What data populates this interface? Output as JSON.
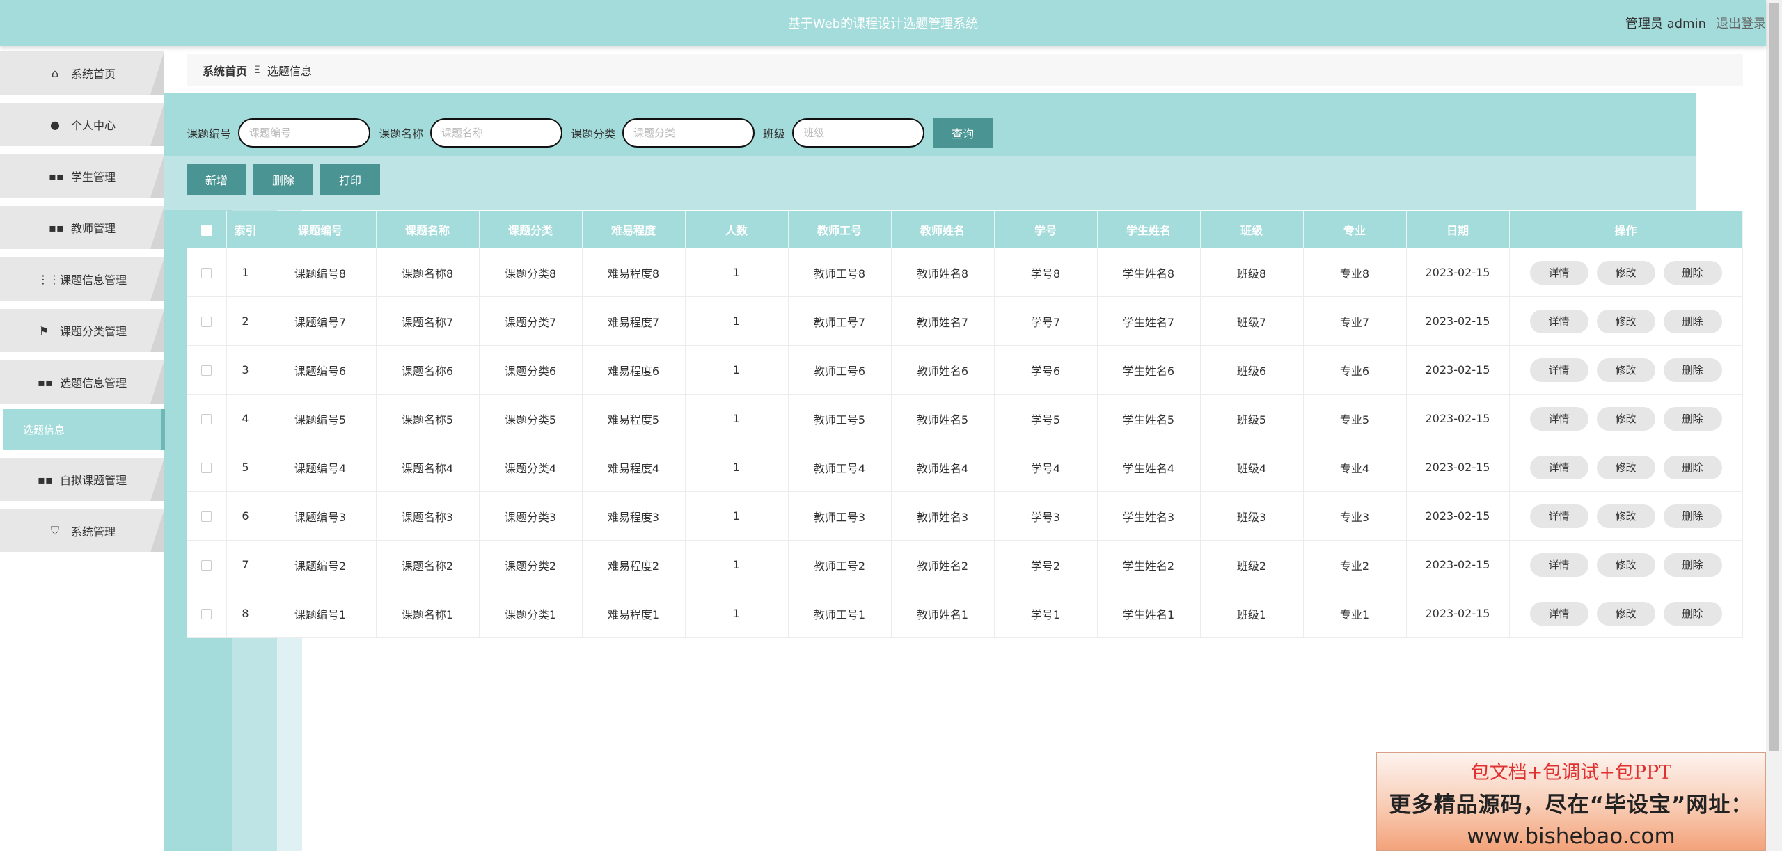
{
  "header": {
    "title": "基于Web的课程设计选题管理系统",
    "user_label": "管理员 admin",
    "logout": "退出登录"
  },
  "sidebar": {
    "items": [
      {
        "label": "系统首页",
        "icon": "home-icon"
      },
      {
        "label": "个人中心",
        "icon": "user-icon"
      },
      {
        "label": "学生管理",
        "icon": "grid-icon"
      },
      {
        "label": "教师管理",
        "icon": "grid-icon"
      },
      {
        "label": "课题信息管理",
        "icon": "apps-icon"
      },
      {
        "label": "课题分类管理",
        "icon": "flag-icon"
      },
      {
        "label": "选题信息管理",
        "icon": "grid-icon"
      },
      {
        "label": "自拟课题管理",
        "icon": "grid-icon"
      },
      {
        "label": "系统管理",
        "icon": "settings-icon"
      }
    ],
    "active_sub": "选题信息"
  },
  "breadcrumb": {
    "home": "系统首页",
    "sep": "Ξ",
    "current": "选题信息"
  },
  "search": {
    "fields": [
      {
        "label": "课题编号",
        "placeholder": "课题编号"
      },
      {
        "label": "课题名称",
        "placeholder": "课题名称"
      },
      {
        "label": "课题分类",
        "placeholder": "课题分类"
      },
      {
        "label": "班级",
        "placeholder": "班级"
      }
    ],
    "query_label": "查询"
  },
  "actions": {
    "add": "新增",
    "delete": "删除",
    "print": "打印"
  },
  "table": {
    "headers": [
      "索引",
      "课题编号",
      "课题名称",
      "课题分类",
      "难易程度",
      "人数",
      "教师工号",
      "教师姓名",
      "学号",
      "学生姓名",
      "班级",
      "专业",
      "日期",
      "操作"
    ],
    "row_buttons": {
      "detail": "详情",
      "edit": "修改",
      "delete": "删除"
    },
    "rows": [
      [
        "1",
        "课题编号8",
        "课题名称8",
        "课题分类8",
        "难易程度8",
        "1",
        "教师工号8",
        "教师姓名8",
        "学号8",
        "学生姓名8",
        "班级8",
        "专业8",
        "2023-02-15"
      ],
      [
        "2",
        "课题编号7",
        "课题名称7",
        "课题分类7",
        "难易程度7",
        "1",
        "教师工号7",
        "教师姓名7",
        "学号7",
        "学生姓名7",
        "班级7",
        "专业7",
        "2023-02-15"
      ],
      [
        "3",
        "课题编号6",
        "课题名称6",
        "课题分类6",
        "难易程度6",
        "1",
        "教师工号6",
        "教师姓名6",
        "学号6",
        "学生姓名6",
        "班级6",
        "专业6",
        "2023-02-15"
      ],
      [
        "4",
        "课题编号5",
        "课题名称5",
        "课题分类5",
        "难易程度5",
        "1",
        "教师工号5",
        "教师姓名5",
        "学号5",
        "学生姓名5",
        "班级5",
        "专业5",
        "2023-02-15"
      ],
      [
        "5",
        "课题编号4",
        "课题名称4",
        "课题分类4",
        "难易程度4",
        "1",
        "教师工号4",
        "教师姓名4",
        "学号4",
        "学生姓名4",
        "班级4",
        "专业4",
        "2023-02-15"
      ],
      [
        "6",
        "课题编号3",
        "课题名称3",
        "课题分类3",
        "难易程度3",
        "1",
        "教师工号3",
        "教师姓名3",
        "学号3",
        "学生姓名3",
        "班级3",
        "专业3",
        "2023-02-15"
      ],
      [
        "7",
        "课题编号2",
        "课题名称2",
        "课题分类2",
        "难易程度2",
        "1",
        "教师工号2",
        "教师姓名2",
        "学号2",
        "学生姓名2",
        "班级2",
        "专业2",
        "2023-02-15"
      ],
      [
        "8",
        "课题编号1",
        "课题名称1",
        "课题分类1",
        "难易程度1",
        "1",
        "教师工号1",
        "教师姓名1",
        "学号1",
        "学生姓名1",
        "班级1",
        "专业1",
        "2023-02-15"
      ]
    ]
  },
  "ad": {
    "line1": "包文档+包调试+包PPT",
    "line2": "更多精品源码，尽在“毕设宝”网址：",
    "line3": "www.bishebao.com"
  },
  "colors": {
    "header": "#a3dcdb",
    "button": "#4a9593",
    "panel": "#bfe4e5"
  }
}
